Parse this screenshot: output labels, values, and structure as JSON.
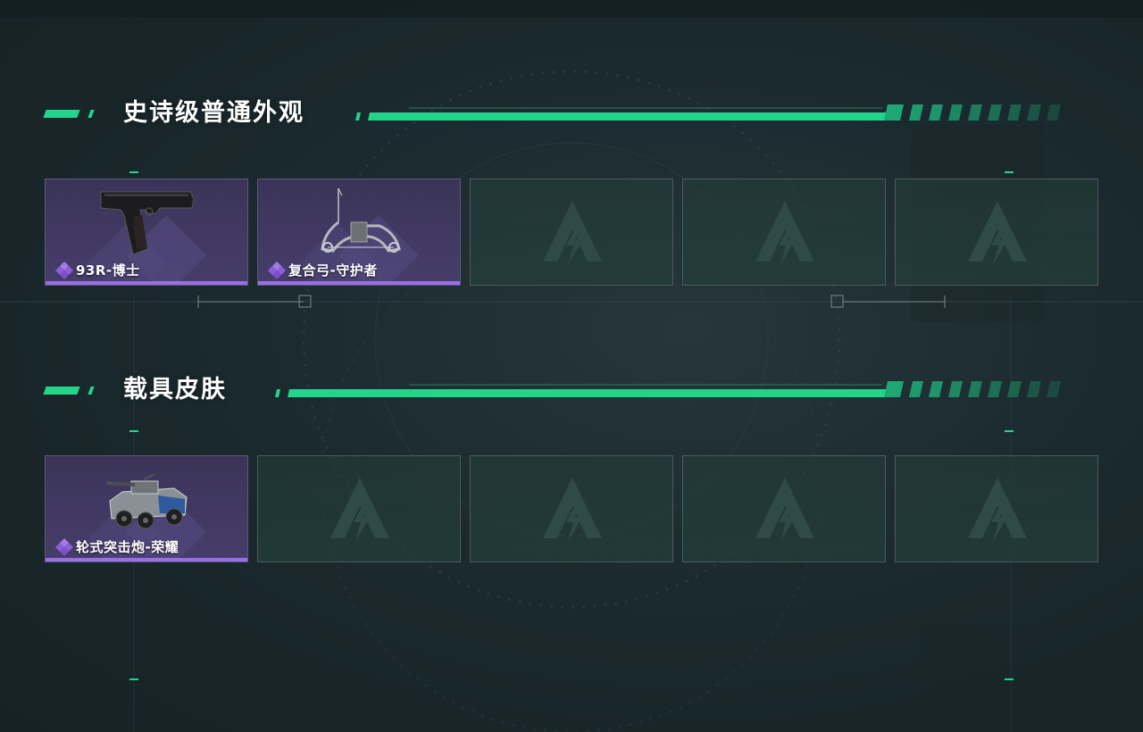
{
  "sections": [
    {
      "title": "史诗级普通外观",
      "items": [
        {
          "name": "93R-博士",
          "art": "pistol"
        },
        {
          "name": "复合弓-守护者",
          "art": "compound-bow"
        }
      ],
      "empty_slots": 3
    },
    {
      "title": "载具皮肤",
      "items": [
        {
          "name": "轮式突击炮-荣耀",
          "art": "armored-vehicle"
        }
      ],
      "empty_slots": 4
    }
  ],
  "colors": {
    "accent_green": "#22d58b",
    "epic_purple": "#9a6ee6",
    "slot_border": "#4b5a5b"
  },
  "icons": {
    "rarity": "purple-diamond-cluster-icon",
    "empty_slot": "triangle-logo-icon"
  }
}
